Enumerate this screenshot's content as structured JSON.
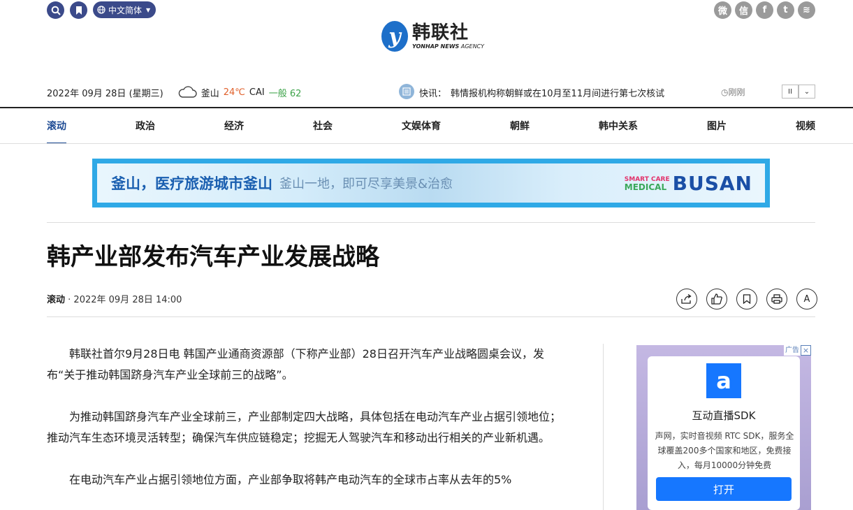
{
  "header": {
    "search_icon": "search-icon",
    "bookmark_icon": "bookmark-icon",
    "lang_label": "中文简体",
    "social": [
      {
        "name": "weibo-icon",
        "glyph": "微"
      },
      {
        "name": "wechat-icon",
        "glyph": "信"
      },
      {
        "name": "facebook-icon",
        "glyph": "f"
      },
      {
        "name": "twitter-icon",
        "glyph": "t"
      },
      {
        "name": "rss-icon",
        "glyph": "≋"
      }
    ],
    "logo_mark": "y",
    "logo_cn": "韩联社",
    "logo_en_bold": "YONHAP NEWS",
    "logo_en_light": " AGENCY"
  },
  "info": {
    "date": "2022年 09月 28日 (星期三)",
    "city": "釜山",
    "temp": "24℃",
    "cai_label": "CAI",
    "cai_value": "一般 62",
    "flash_label": "快讯：",
    "flash_text": "韩情报机构称朝鲜或在10月至11月间进行第七次核试",
    "time_ago": "刚刚",
    "pause_glyph": "II",
    "down_glyph": "⌄"
  },
  "nav": {
    "items": [
      "滚动",
      "政治",
      "经济",
      "社会",
      "文娱体育",
      "朝鲜",
      "韩中关系",
      "图片",
      "视频"
    ]
  },
  "banner": {
    "main": "釜山，医疗旅游城市釜山",
    "sub": "釜山一地，即可尽享美景&治愈",
    "sc_line1": "SMART CARE",
    "sc_line2": "MEDICAL",
    "brand": "BUSAN"
  },
  "article": {
    "title": "韩产业部发布汽车产业发展战略",
    "category": "滚动",
    "separator": " · ",
    "datetime": "2022年 09月 28日 14:00",
    "paragraphs": [
      "韩联社首尔9月28日电 韩国产业通商资源部（下称产业部）28日召开汽车产业战略圆桌会议，发布“关于推动韩国跻身汽车产业全球前三的战略”。",
      "为推动韩国跻身汽车产业全球前三，产业部制定四大战略，具体包括在电动汽车产业占据引领地位；推动汽车生态环境灵活转型；确保汽车供应链稳定；挖掘无人驾驶汽车和移动出行相关的产业新机遇。",
      "在电动汽车产业占据引领地位方面，产业部争取将韩产电动汽车的全球市占率从去年的5%"
    ],
    "font_tool": "A"
  },
  "ad": {
    "tag": "广告",
    "close": "×",
    "logo_glyph": "a",
    "title": "互动直播SDK",
    "desc": "声网，实时音视频 RTC SDK，服务全球覆盖200多个国家和地区，免费接入，每月10000分钟免费",
    "button": "打开"
  },
  "colors": {
    "brand_navy": "#3b4a8a",
    "nav_active": "#1d4a93",
    "temp": "#e0602a",
    "cai": "#3ea34a",
    "ad_button": "#1677ff"
  }
}
